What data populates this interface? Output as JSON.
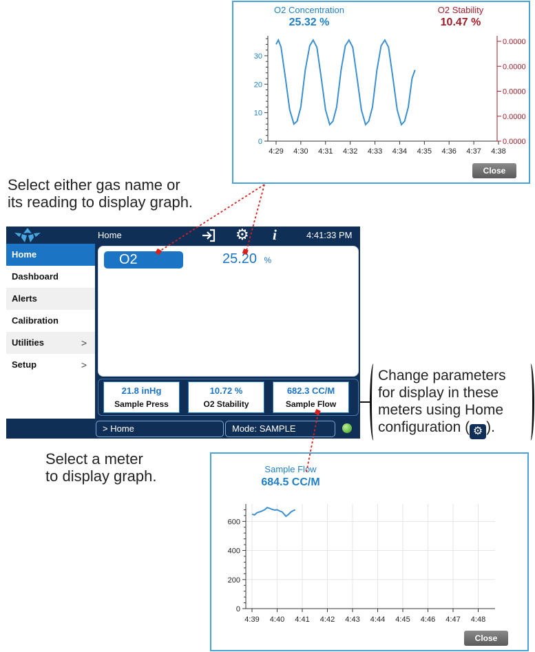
{
  "colors": {
    "accent_blue": "#1b74c4",
    "navy": "#102f57",
    "stability_red": "#a01c28",
    "panel_border": "#4aa3d8",
    "status_green": "#6cc24a",
    "annotation_red": "#d9201c"
  },
  "callouts": {
    "gas_select": [
      "Select either gas name or",
      "its reading to display graph."
    ],
    "meter_select": [
      "Select a meter",
      "to display graph."
    ],
    "change_params": [
      "Change parameters",
      "for display in these",
      "meters using Home"
    ],
    "change_params_last_before": "configuration (",
    "change_params_last_after": ")."
  },
  "device": {
    "title": "Home",
    "time": "4:41:33 PM",
    "icons": [
      "sign-in-icon",
      "gear-icon",
      "info-icon"
    ],
    "sidebar": [
      {
        "label": "Home",
        "has_submenu": false
      },
      {
        "label": "Dashboard",
        "has_submenu": false
      },
      {
        "label": "Alerts",
        "has_submenu": false
      },
      {
        "label": "Calibration",
        "has_submenu": false
      },
      {
        "label": "Utilities",
        "has_submenu": true,
        "chevron": ">"
      },
      {
        "label": "Setup",
        "has_submenu": true,
        "chevron": ">"
      }
    ],
    "active_item": "Home",
    "gas": {
      "name": "O2",
      "value": "25.20",
      "unit": "%"
    },
    "meters": [
      {
        "value": "21.8 inHg",
        "label": "Sample Press"
      },
      {
        "value": "10.72 %",
        "label": "O2 Stability"
      },
      {
        "value": "682.3 CC/M",
        "label": "Sample Flow"
      }
    ],
    "breadcrumb": "> Home",
    "mode": "Mode: SAMPLE"
  },
  "o2_graph": {
    "close_label": "Close",
    "chart_data": {
      "type": "line",
      "series": [
        {
          "name": "O2 Concentration",
          "reading": "25.32 %",
          "color": "#1f7fc4",
          "axis": "left"
        },
        {
          "name": "O2 Stability",
          "reading": "10.47 %",
          "color": "#a01c28",
          "axis": "right"
        }
      ],
      "x_ticks": [
        "4:29",
        "4:30",
        "4:31",
        "4:32",
        "4:33",
        "4:34",
        "4:35",
        "4:36",
        "4:37",
        "4:38"
      ],
      "y_ticks": [
        "0",
        "10",
        "20",
        "30"
      ],
      "y_right_ticks": [
        "0.0000",
        "0.0000",
        "0.0000",
        "0.0000",
        "0.0000"
      ],
      "ylim": [
        0,
        37
      ],
      "o2_concentration_points": [
        [
          0.0,
          34.0
        ],
        [
          0.09,
          35.5
        ],
        [
          0.2,
          33.0
        ],
        [
          0.38,
          22.0
        ],
        [
          0.55,
          11.0
        ],
        [
          0.72,
          6.0
        ],
        [
          0.85,
          7.0
        ],
        [
          1.0,
          12.0
        ],
        [
          1.18,
          25.0
        ],
        [
          1.36,
          33.5
        ],
        [
          1.5,
          35.5
        ],
        [
          1.65,
          33.0
        ],
        [
          1.83,
          22.0
        ],
        [
          2.0,
          11.0
        ],
        [
          2.17,
          5.8
        ],
        [
          2.3,
          7.0
        ],
        [
          2.45,
          12.0
        ],
        [
          2.63,
          25.0
        ],
        [
          2.8,
          33.5
        ],
        [
          2.95,
          35.5
        ],
        [
          3.1,
          33.0
        ],
        [
          3.28,
          22.0
        ],
        [
          3.45,
          11.0
        ],
        [
          3.62,
          5.8
        ],
        [
          3.75,
          7.0
        ],
        [
          3.9,
          12.0
        ],
        [
          4.08,
          25.0
        ],
        [
          4.25,
          33.5
        ],
        [
          4.4,
          35.5
        ],
        [
          4.55,
          33.0
        ],
        [
          4.73,
          22.0
        ],
        [
          4.9,
          11.0
        ],
        [
          5.07,
          5.8
        ],
        [
          5.2,
          7.0
        ],
        [
          5.35,
          12.0
        ],
        [
          5.5,
          22.0
        ],
        [
          5.62,
          25.0
        ]
      ]
    }
  },
  "flow_graph": {
    "close_label": "Close",
    "chart_data": {
      "type": "line",
      "series": [
        {
          "name": "Sample Flow",
          "reading": "684.5 CC/M",
          "color": "#1f7fc4"
        }
      ],
      "x_ticks": [
        "4:39",
        "4:40",
        "4:41",
        "4:42",
        "4:43",
        "4:44",
        "4:45",
        "4:46",
        "4:47",
        "4:48"
      ],
      "y_ticks": [
        "0",
        "200",
        "400",
        "600"
      ],
      "ylim": [
        0,
        720
      ],
      "points": [
        [
          0.0,
          650
        ],
        [
          0.1,
          645
        ],
        [
          0.2,
          660
        ],
        [
          0.35,
          668
        ],
        [
          0.5,
          680
        ],
        [
          0.6,
          695
        ],
        [
          0.7,
          690
        ],
        [
          0.8,
          683
        ],
        [
          0.9,
          678
        ],
        [
          1.0,
          680
        ],
        [
          1.1,
          672
        ],
        [
          1.2,
          665
        ],
        [
          1.3,
          645
        ],
        [
          1.35,
          635
        ],
        [
          1.45,
          648
        ],
        [
          1.55,
          665
        ],
        [
          1.65,
          675
        ],
        [
          1.72,
          680
        ]
      ]
    }
  }
}
